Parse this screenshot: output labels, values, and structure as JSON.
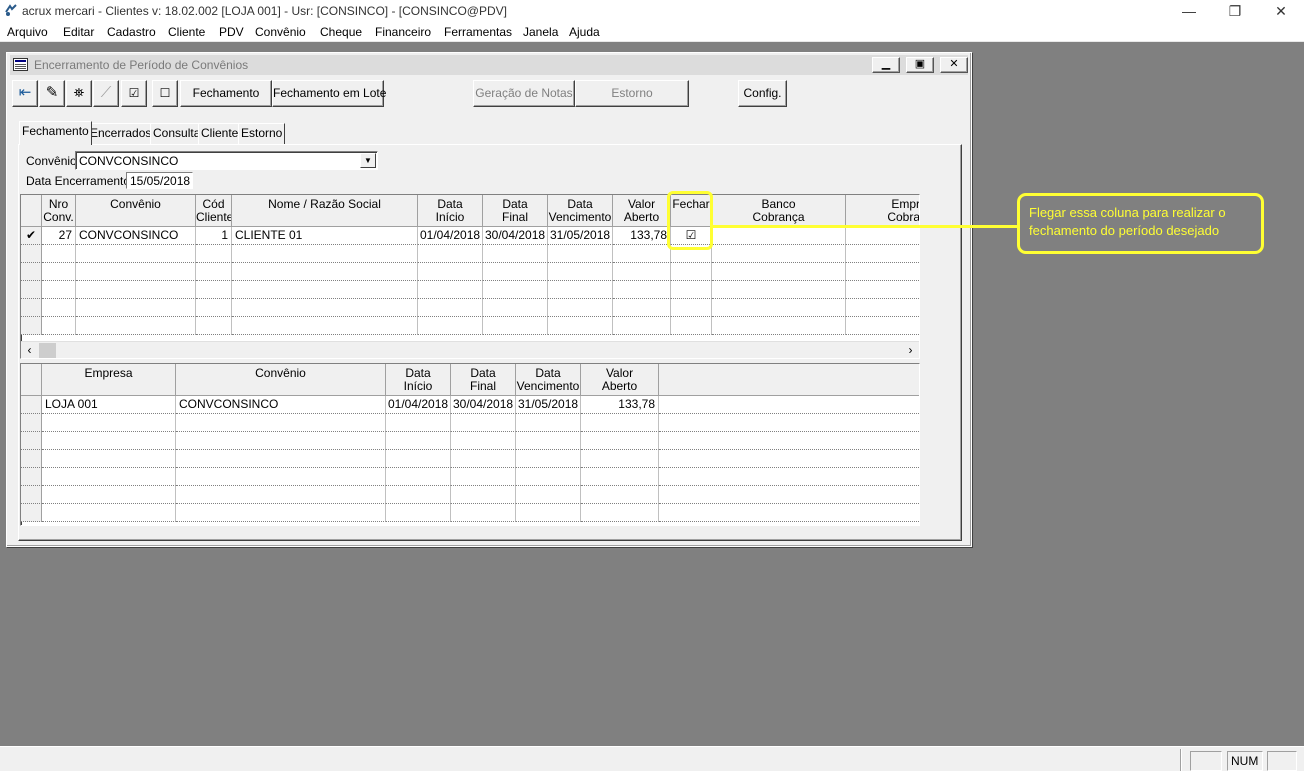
{
  "app": {
    "title": "acrux mercari - Clientes  v: 18.02.002  [LOJA 001] - Usr: [CONSINCO] - [CONSINCO@PDV]"
  },
  "menu": [
    "Arquivo",
    "Editar",
    "Cadastro",
    "Cliente",
    "PDV",
    "Convênio",
    "Cheque",
    "Financeiro",
    "Ferramentas",
    "Janela",
    "Ajuda"
  ],
  "child_window": {
    "title": "Encerramento de Período de Convênios"
  },
  "toolbar": {
    "fechamento": "Fechamento",
    "fechamento_lote": "Fechamento em Lote",
    "geracao_notas": "Geração de Notas",
    "estorno": "Estorno",
    "config": "Config."
  },
  "tabs": [
    "Fechamento",
    "Encerrados",
    "Consulta",
    "Cliente",
    "Estorno"
  ],
  "form": {
    "convenio_label": "Convênio",
    "convenio_value": "CONVCONSINCO",
    "data_label": "Data Encerramento",
    "data_value": "15/05/2018"
  },
  "grid1": {
    "headers": [
      [
        "Nro",
        "Conv."
      ],
      [
        "Convênio",
        ""
      ],
      [
        "Cód",
        "Cliente"
      ],
      [
        "Nome / Razão Social",
        ""
      ],
      [
        "Data",
        "Início"
      ],
      [
        "Data",
        "Final"
      ],
      [
        "Data",
        "Vencimento"
      ],
      [
        "Valor",
        "Aberto"
      ],
      [
        "Fechar",
        ""
      ],
      [
        "Banco",
        "Cobrança"
      ],
      [
        "Empr",
        "Cobra"
      ]
    ],
    "rows": [
      {
        "nro": "27",
        "convenio": "CONVCONSINCO",
        "cod": "1",
        "nome": "CLIENTE 01",
        "inicio": "01/04/2018",
        "final": "30/04/2018",
        "venc": "31/05/2018",
        "valor": "133,78",
        "fechar": "☑",
        "selected_mark": "✔"
      }
    ]
  },
  "grid2": {
    "headers": [
      [
        "Empresa",
        ""
      ],
      [
        "Convênio",
        ""
      ],
      [
        "Data",
        "Início"
      ],
      [
        "Data",
        "Final"
      ],
      [
        "Data",
        "Vencimento"
      ],
      [
        "Valor",
        "Aberto"
      ]
    ],
    "rows": [
      {
        "empresa": "LOJA 001",
        "convenio": "CONVCONSINCO",
        "inicio": "01/04/2018",
        "final": "30/04/2018",
        "venc": "31/05/2018",
        "valor": "133,78"
      }
    ]
  },
  "annotation": {
    "text": "Flegar essa coluna para realizar o fechamento do período desejado"
  },
  "statusbar": {
    "num": "NUM"
  },
  "colors": {
    "mdi_background": "#808080",
    "annotation": "#ffff33"
  }
}
